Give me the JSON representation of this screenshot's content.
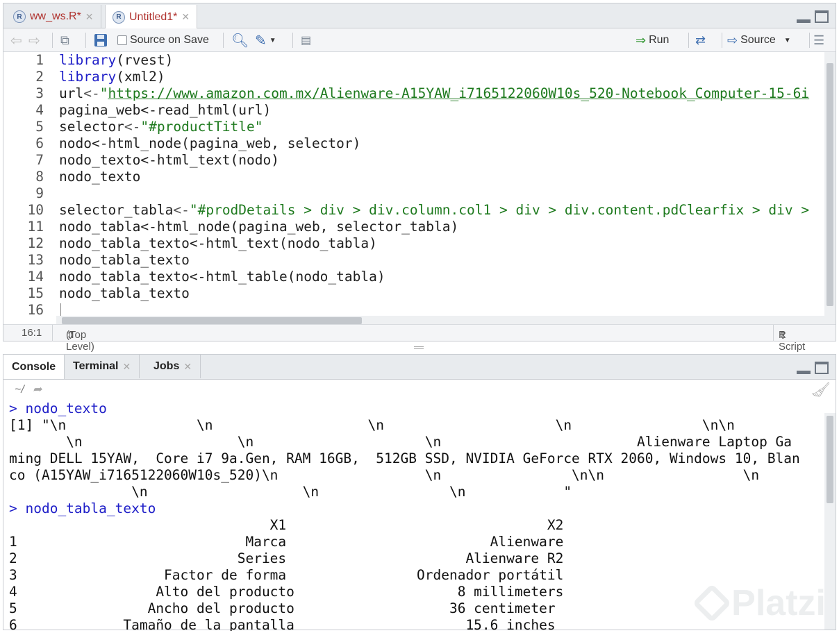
{
  "editor": {
    "tabs": [
      {
        "label": "ww_ws.R*",
        "icon": "r-file-icon"
      },
      {
        "label": "Untitled1*",
        "icon": "r-file-icon"
      }
    ],
    "toolbar": {
      "source_on_save": "Source on Save",
      "run": "Run",
      "source": "Source"
    },
    "lines": [
      {
        "n": "1",
        "t": "library(rvest)"
      },
      {
        "n": "2",
        "t": "library(xml2)"
      },
      {
        "n": "3",
        "t": "url<-\"https://www.amazon.com.mx/Alienware-A15YAW_i7165122060W10s_520-Notebook_Computer-15-6i"
      },
      {
        "n": "4",
        "t": "pagina_web<-read_html(url)"
      },
      {
        "n": "5",
        "t": "selector<-\"#productTitle\""
      },
      {
        "n": "6",
        "t": "nodo<-html_node(pagina_web, selector)"
      },
      {
        "n": "7",
        "t": "nodo_texto<-html_text(nodo)"
      },
      {
        "n": "8",
        "t": "nodo_texto"
      },
      {
        "n": "9",
        "t": ""
      },
      {
        "n": "10",
        "t": "selector_tabla<-\"#prodDetails > div > div.column.col1 > div > div.content.pdClearfix > div >"
      },
      {
        "n": "11",
        "t": "nodo_tabla<-html_node(pagina_web, selector_tabla)"
      },
      {
        "n": "12",
        "t": "nodo_tabla_texto<-html_text(nodo_tabla)"
      },
      {
        "n": "13",
        "t": "nodo_tabla_texto"
      },
      {
        "n": "14",
        "t": "nodo_tabla_texto<-html_table(nodo_tabla)"
      },
      {
        "n": "15",
        "t": "nodo_tabla_texto"
      },
      {
        "n": "16",
        "t": ""
      }
    ],
    "status": {
      "position": "16:1",
      "scope": "(Top Level)",
      "file_type": "R Script"
    }
  },
  "console": {
    "tabs": [
      {
        "label": "Console"
      },
      {
        "label": "Terminal"
      },
      {
        "label": "Jobs"
      }
    ],
    "path": "~/",
    "lines": [
      {
        "prompt": "> ",
        "t": "nodo_texto"
      },
      {
        "prompt": "",
        "t": "[1] \"\\n                \\n                   \\n                     \\n                \\n\\n"
      },
      {
        "prompt": "",
        "t": "       \\n                   \\n                     \\n                        Alienware Laptop Ga"
      },
      {
        "prompt": "",
        "t": "ming DELL 15YAW,  Core i7 9a.Gen, RAM 16GB,  512GB SSD, NVIDIA GeForce RTX 2060, Windows 10, Blan"
      },
      {
        "prompt": "",
        "t": "co (A15YAW_i7165122060W10s_520)\\n                  \\n                \\n\\n                 \\n"
      },
      {
        "prompt": "",
        "t": "               \\n                   \\n                \\n            \""
      },
      {
        "prompt": "> ",
        "t": "nodo_tabla_texto"
      },
      {
        "prompt": "",
        "t": "                                X1                                X2"
      },
      {
        "prompt": "",
        "t": "1                            Marca                         Alienware"
      },
      {
        "prompt": "",
        "t": "2                           Series                      Alienware R2"
      },
      {
        "prompt": "",
        "t": "3                  Factor de forma                Ordenador portátil"
      },
      {
        "prompt": "",
        "t": "4                 Alto del producto                    8 millimeters"
      },
      {
        "prompt": "",
        "t": "5                Ancho del producto                   36 centimeter"
      },
      {
        "prompt": "",
        "t": "6             Tamaño de la pantalla                     15.6 inches"
      }
    ]
  },
  "watermark": "Platzi"
}
